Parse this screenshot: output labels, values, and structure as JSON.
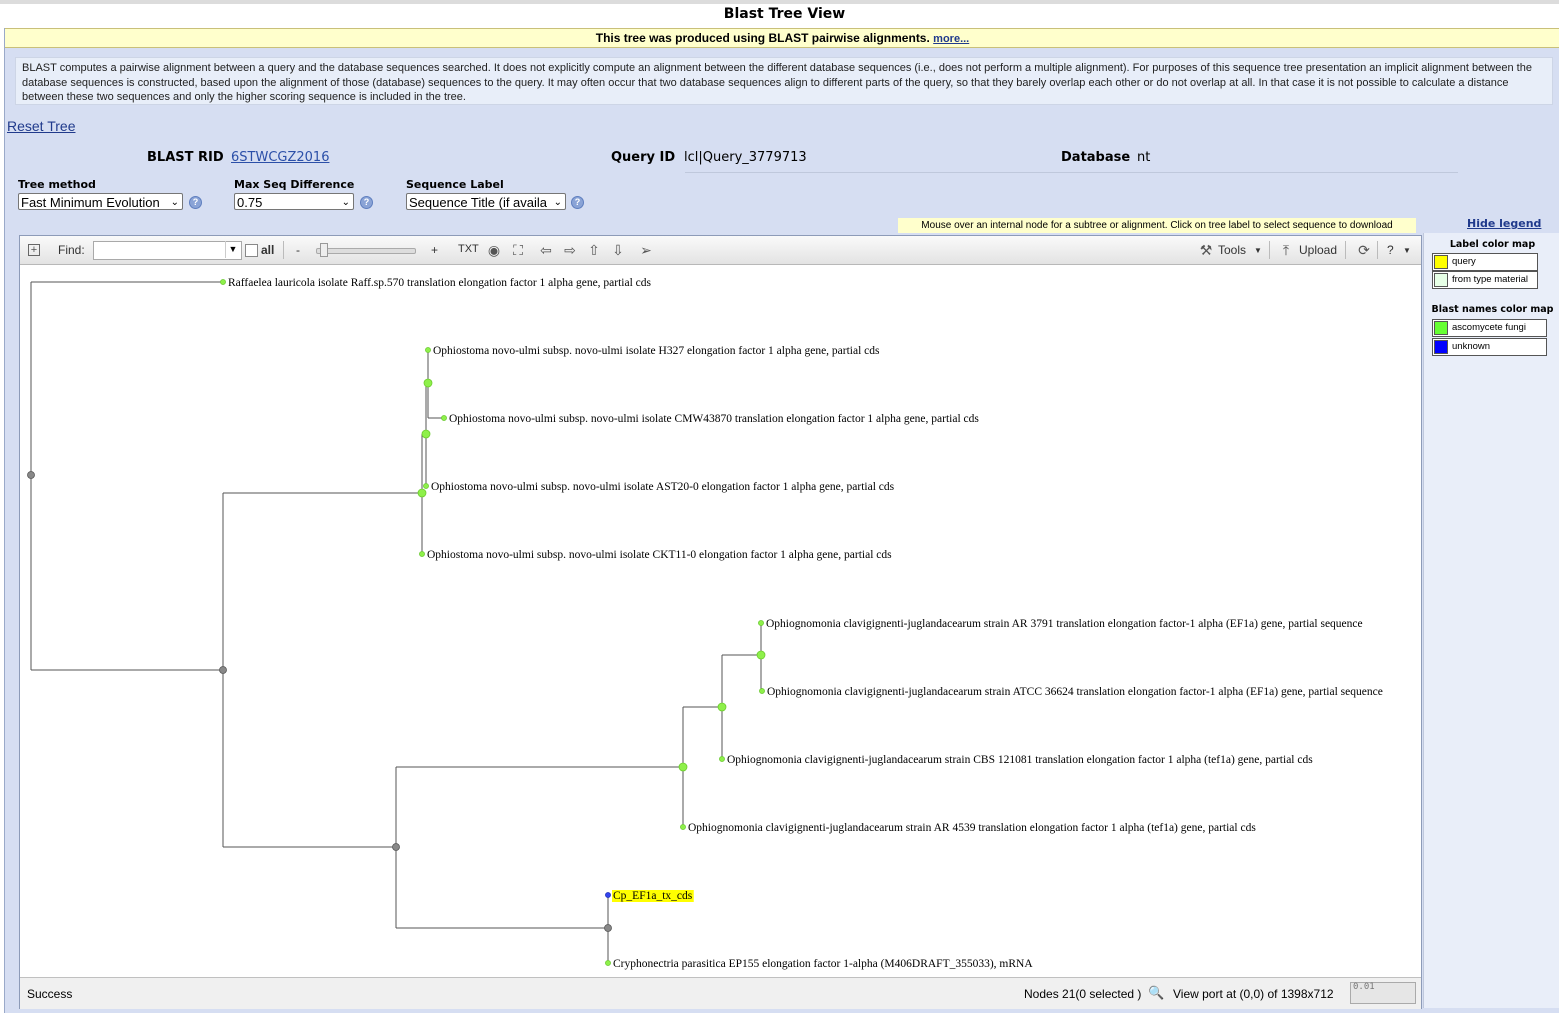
{
  "page": {
    "title": "Blast Tree View",
    "banner_text": "This tree was produced using BLAST pairwise alignments.",
    "banner_link": "more...",
    "info": "BLAST computes a pairwise alignment between a query and the database sequences searched. It does not explicitly compute an alignment between the different database sequences (i.e., does not perform a multiple alignment). For purposes of this sequence tree presentation an implicit alignment between the database sequences is constructed, based upon the alignment of those (database) sequences to the query. It may often occur that two database sequences align to different parts of the query, so that they barely overlap each other or do not overlap at all. In that case it is not possible to calculate a distance between these two sequences and only the higher scoring sequence is included in the tree.",
    "reset_link": "Reset Tree"
  },
  "meta": {
    "rid_label": "BLAST RID",
    "rid_value": "6STWCGZ2016",
    "query_label": "Query ID",
    "query_value": "lcl|Query_3779713",
    "db_label": "Database",
    "db_value": "nt"
  },
  "options": {
    "tree_method_label": "Tree method",
    "tree_method_value": "Fast Minimum Evolution",
    "max_seq_label": "Max Seq Difference",
    "max_seq_value": "0.75",
    "seq_label_label": "Sequence Label",
    "seq_label_value": "Sequence Title (if availa"
  },
  "hint": "Mouse over an internal node for a subtree or alignment. Click on tree label to select sequence to download",
  "toolbar": {
    "find_label": "Find:",
    "all_label": "all",
    "minus": "-",
    "plus": "+",
    "txt": "TXT",
    "tools": "Tools",
    "upload": "Upload",
    "help": "?"
  },
  "tree": {
    "leaves": [
      {
        "label": "Raffaelea lauricola isolate Raff.sp.570 translation elongation factor 1 alpha gene, partial cds",
        "group": "ascomycete fungi",
        "query": false
      },
      {
        "label": "Ophiostoma novo-ulmi subsp. novo-ulmi isolate H327 elongation factor 1 alpha gene, partial cds",
        "group": "ascomycete fungi",
        "query": false
      },
      {
        "label": "Ophiostoma novo-ulmi subsp. novo-ulmi isolate CMW43870 translation elongation factor 1 alpha gene, partial cds",
        "group": "ascomycete fungi",
        "query": false
      },
      {
        "label": "Ophiostoma novo-ulmi subsp. novo-ulmi isolate AST20-0 elongation factor 1 alpha gene, partial cds",
        "group": "ascomycete fungi",
        "query": false
      },
      {
        "label": "Ophiostoma novo-ulmi subsp. novo-ulmi isolate CKT11-0 elongation factor 1 alpha gene, partial cds",
        "group": "ascomycete fungi",
        "query": false
      },
      {
        "label": "Ophiognomonia clavigignenti-juglandacearum strain AR 3791 translation elongation factor-1 alpha (EF1a) gene, partial sequence",
        "group": "ascomycete fungi",
        "query": false
      },
      {
        "label": "Ophiognomonia clavigignenti-juglandacearum strain ATCC 36624 translation elongation factor-1 alpha (EF1a) gene, partial sequence",
        "group": "ascomycete fungi",
        "query": false
      },
      {
        "label": "Ophiognomonia clavigignenti-juglandacearum strain CBS 121081 translation elongation factor 1 alpha (tef1a) gene, partial cds",
        "group": "ascomycete fungi",
        "query": false
      },
      {
        "label": "Ophiognomonia clavigignenti-juglandacearum strain AR 4539 translation elongation factor 1 alpha (tef1a) gene, partial cds",
        "group": "ascomycete fungi",
        "query": false
      },
      {
        "label": "Cp_EF1a_tx_cds",
        "group": "unknown",
        "query": true
      },
      {
        "label": "Cryphonectria parasitica EP155 elongation factor 1-alpha (M406DRAFT_355033), mRNA",
        "group": "ascomycete fungi",
        "query": false
      }
    ]
  },
  "status": {
    "message": "Success",
    "nodes": "Nodes 21(0 selected )",
    "viewport": "View port at (0,0)  of 1398x712",
    "scale": "0.01"
  },
  "legend": {
    "toggle": "Hide legend",
    "label_map_title": "Label color map",
    "label_map": [
      {
        "name": "query",
        "color": "#ffff00"
      },
      {
        "name": "from type material",
        "color": "#e6ffe6"
      }
    ],
    "blast_map_title": "Blast names color map",
    "blast_map": [
      {
        "name": "ascomycete fungi",
        "color": "#66ff33"
      },
      {
        "name": "unknown",
        "color": "#0000ff"
      }
    ]
  },
  "colors": {
    "accent_link": "#203a8c",
    "panel_bg": "#d6def2",
    "query_highlight": "#ffff00",
    "fungi_node": "#8ef04a",
    "unknown_node": "#3344ee",
    "internal_node": "#888888"
  }
}
